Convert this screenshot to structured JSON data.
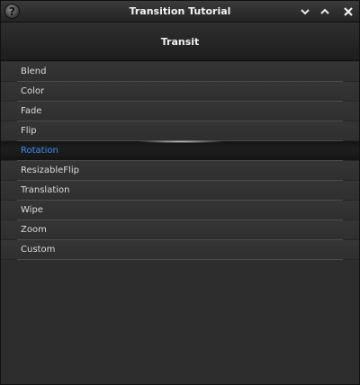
{
  "window": {
    "title": "Transition Tutorial",
    "help_glyph": "?",
    "controls": [
      "chevron-down-icon",
      "chevron-up-icon",
      "close-icon"
    ]
  },
  "header": {
    "title": "Transit"
  },
  "list": {
    "selected": "Rotation",
    "selected_color": "#3f8df5",
    "items": [
      {
        "label": "Blend"
      },
      {
        "label": "Color"
      },
      {
        "label": "Fade"
      },
      {
        "label": "Flip"
      },
      {
        "label": "Rotation"
      },
      {
        "label": "ResizableFlip"
      },
      {
        "label": "Translation"
      },
      {
        "label": "Wipe"
      },
      {
        "label": "Zoom"
      },
      {
        "label": "Custom"
      }
    ]
  }
}
